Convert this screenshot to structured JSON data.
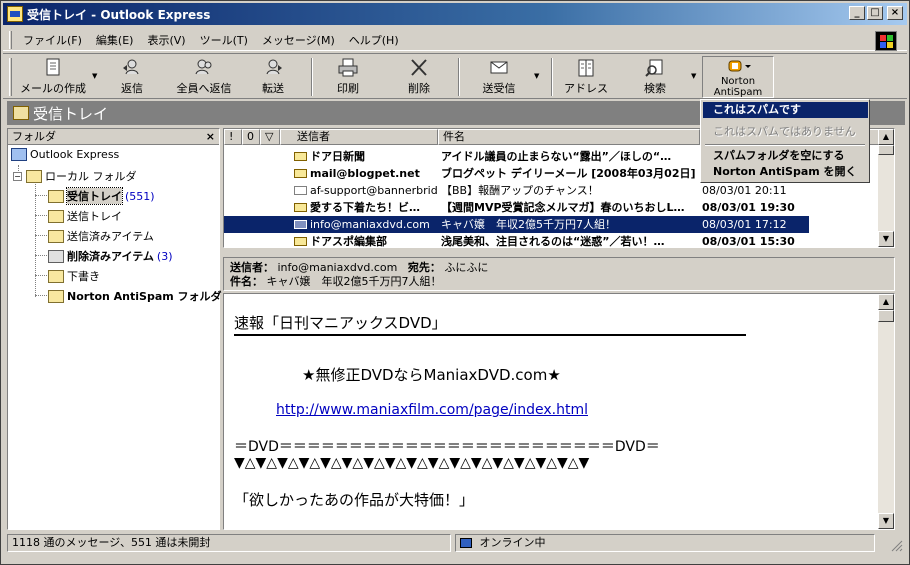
{
  "window": {
    "title": "受信トレイ - Outlook Express"
  },
  "menu": [
    "ファイル(F)",
    "編集(E)",
    "表示(V)",
    "ツール(T)",
    "メッセージ(M)",
    "ヘルプ(H)"
  ],
  "toolbar": {
    "new_mail": "メールの作成",
    "reply": "返信",
    "reply_all": "全員へ返信",
    "forward": "転送",
    "print": "印刷",
    "delete": "削除",
    "send_receive": "送受信",
    "addresses": "アドレス",
    "find": "検索",
    "norton": "Norton AntiSpam"
  },
  "folder_band": "受信トレイ",
  "folder_pane": {
    "header": "フォルダ",
    "close": "×",
    "items": [
      {
        "label": "Outlook Express",
        "count": ""
      },
      {
        "label": "ローカル フォルダ",
        "count": ""
      },
      {
        "label": "受信トレイ",
        "count": "(551)"
      },
      {
        "label": "送信トレイ",
        "count": ""
      },
      {
        "label": "送信済みアイテム",
        "count": ""
      },
      {
        "label": "削除済みアイテム",
        "count": "(3)"
      },
      {
        "label": "下書き",
        "count": ""
      },
      {
        "label": "Norton AntiSpam フォルダ",
        "count": ""
      }
    ]
  },
  "msg_columns": {
    "priority": "!",
    "attach": "0",
    "flag": "▽",
    "from": "送信者",
    "subject": "件名"
  },
  "messages": [
    {
      "from": "ドア日新聞",
      "subject": "アイドル議員の止まらない“露出”／ほしの“…",
      "date": ""
    },
    {
      "from": "mail@blogpet.net",
      "subject": "ブログペット デイリーメール [2008年03月02日]",
      "date": ""
    },
    {
      "from": "af-support@bannerbrid…",
      "subject": "【BB】報酬アップのチャンス！",
      "date": "08/03/01 20:11"
    },
    {
      "from": "愛する下着たち！ビ…",
      "subject": "【週間MVP受賞記念メルマガ】春のいちおしL…",
      "date": "08/03/01 19:30"
    },
    {
      "from": "info@maniaxdvd.com",
      "subject": "キャバ嬢　年収2億5千万円7人組！",
      "date": "08/03/01 17:12"
    },
    {
      "from": "ドアスポ編集部",
      "subject": "浅尾美和、注目されるのは“迷惑”／若い！…",
      "date": "08/03/01 15:30"
    }
  ],
  "context_menu": [
    "これはスパムです",
    "これはスパムではありません",
    "スパムフォルダを空にする",
    "Norton AntiSpam を開く"
  ],
  "preview": {
    "from_label": "送信者：",
    "from_value": "info@maniaxdvd.com",
    "to_label": "宛先：",
    "to_value": "ふにふに",
    "subject_label": "件名：",
    "subject_value": "キャバ嬢　年収2億5千万円7人組！",
    "body": {
      "line1": "速報「日刊マニアックスDVD」",
      "line2": "★無修正DVDならManiaxDVD.com★",
      "link": "http://www.maniaxfilm.com/page/index.html",
      "line3": "＝DVD＝＝＝＝＝＝＝＝＝＝＝＝＝＝＝＝＝＝＝＝＝＝＝＝DVD＝",
      "line4": "▼△▼△▼△▼△▼△▼△▼△▼△▼△▼△▼△▼△▼△▼△▼△▼△▼",
      "line5": "「欲しかったあの作品が大特価！」"
    }
  },
  "status": {
    "count": "1118 通のメッセージ、551 通は未開封",
    "online": "オンライン中"
  }
}
